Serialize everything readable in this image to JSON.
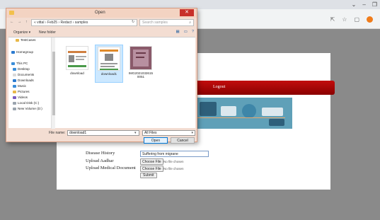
{
  "dialog": {
    "title": "Open",
    "close_glyph": "✕",
    "nav_glyphs": "← → ↑",
    "address_path": "« vittal › Feb25 › Redact › samples",
    "refresh_glyph": "↻",
    "search_placeholder": "Search samples",
    "search_glyph": "⌕",
    "organize_label": "Organize ▾",
    "new_folder_label": "New folder",
    "nav_items": [
      {
        "label": "TestCases",
        "icon": "folder-icon"
      },
      {
        "label": "Homegroup",
        "icon": "homegroup-icon"
      },
      {
        "label": "This PC",
        "icon": "computer-icon"
      },
      {
        "label": "Desktop",
        "icon": "desktop-icon"
      },
      {
        "label": "Documents",
        "icon": "documents-icon"
      },
      {
        "label": "Downloads",
        "icon": "downloads-icon"
      },
      {
        "label": "Music",
        "icon": "music-icon"
      },
      {
        "label": "Pictures",
        "icon": "pictures-icon"
      },
      {
        "label": "Videos",
        "icon": "videos-icon"
      },
      {
        "label": "Local Disk (C:)",
        "icon": "disk-icon"
      },
      {
        "label": "New Volume (D:)",
        "icon": "disk-icon"
      }
    ],
    "files": [
      {
        "name": "download"
      },
      {
        "name": "download1"
      },
      {
        "name": "IMG20210326150051"
      }
    ],
    "file_name_label": "File name:",
    "file_name_value": "download1",
    "filter_value": "All Files",
    "open_label": "Open",
    "cancel_label": "Cancel"
  },
  "page": {
    "logout_label": "Logout",
    "form": {
      "disease_history_label": "Disease History",
      "disease_history_value": "Suffering from migrane",
      "upload_aadhar_label": "Upload Aadhar",
      "upload_medical_label": "Upload Medical Document",
      "choose_file_label": "Choose File",
      "no_file_text": "No file chosen",
      "submit_label": "Submit"
    }
  },
  "browser": {
    "window_controls": [
      "⌄",
      "–",
      "❐"
    ],
    "toolbar_icons": [
      "share-icon",
      "star-icon",
      "tab-icon",
      "profile-icon"
    ]
  },
  "colors": {
    "navbar": "#a00a0a",
    "banner": "#5fa0b8",
    "dialog_frame": "#f3ddd2",
    "close_button": "#c8302a",
    "profile": "#f07c1b"
  }
}
